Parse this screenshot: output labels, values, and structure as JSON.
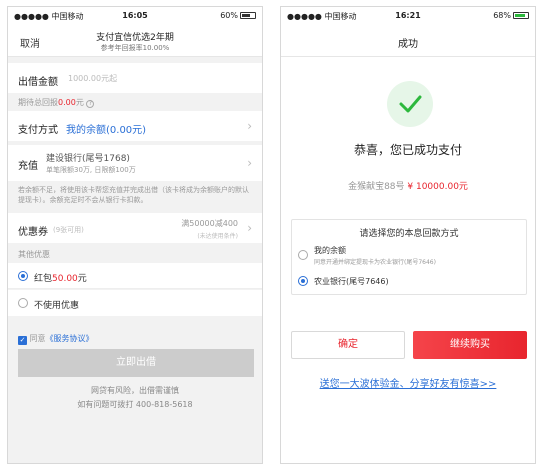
{
  "left": {
    "status": {
      "carrier": "中国移动",
      "time": "16:05",
      "battery": "60%"
    },
    "nav": {
      "cancel": "取消",
      "title": "支付宜信优选2年期",
      "subtitle": "参考年回报率10.00%"
    },
    "amount": {
      "label": "出借金额",
      "placeholder": "1000.00元起"
    },
    "expected": {
      "label": "期待总回报",
      "value": "0.00",
      "unit": "元"
    },
    "payment": {
      "label": "支付方式",
      "value": "我的余额(0.00元)"
    },
    "recharge": {
      "label": "充值",
      "bank": "建设银行(尾号1768)",
      "limit": "单笔限额30万, 日限额100万"
    },
    "notice": "若余额不足，将使用该卡帮您充值并完成出借（该卡将成为余额账户的默认提现卡）。余额充足时不会从银行卡扣款。",
    "coupon": {
      "label": "优惠券",
      "count": "(9张可用)",
      "detail": "满50000减400",
      "note": "(未达使用条件)"
    },
    "other_title": "其他优惠",
    "bonus": {
      "prefix": "红包",
      "amount": "50.00",
      "unit": "元"
    },
    "no_discount": "不使用优惠",
    "agreement": {
      "prefix": "同意",
      "link": "《服务协议》"
    },
    "submit": "立即出借",
    "risk": "网贷有风险，出借需谨慎",
    "hotline": "如有问题可拨打 400-818-5618"
  },
  "right": {
    "status": {
      "carrier": "中国移动",
      "time": "16:21",
      "battery": "68%"
    },
    "nav": {
      "title": "成功"
    },
    "message": "恭喜，您已成功支付",
    "product": "金猴献宝88号",
    "amount": "¥ 10000.00元",
    "choice_title": "请选择您的本息回款方式",
    "options": [
      {
        "title": "我的余额",
        "desc": "同意开通并绑定提现卡为农业银行(尾号7646)",
        "selected": false
      },
      {
        "title": "农业银行(尾号7646)",
        "desc": "",
        "selected": true
      }
    ],
    "confirm": "确定",
    "continue": "继续购买",
    "share": "送您一大波体验金、分享好友有惊喜>>"
  },
  "colors": {
    "accent": "#e8252e",
    "link": "#2a6fd6",
    "success": "#2db83d"
  }
}
